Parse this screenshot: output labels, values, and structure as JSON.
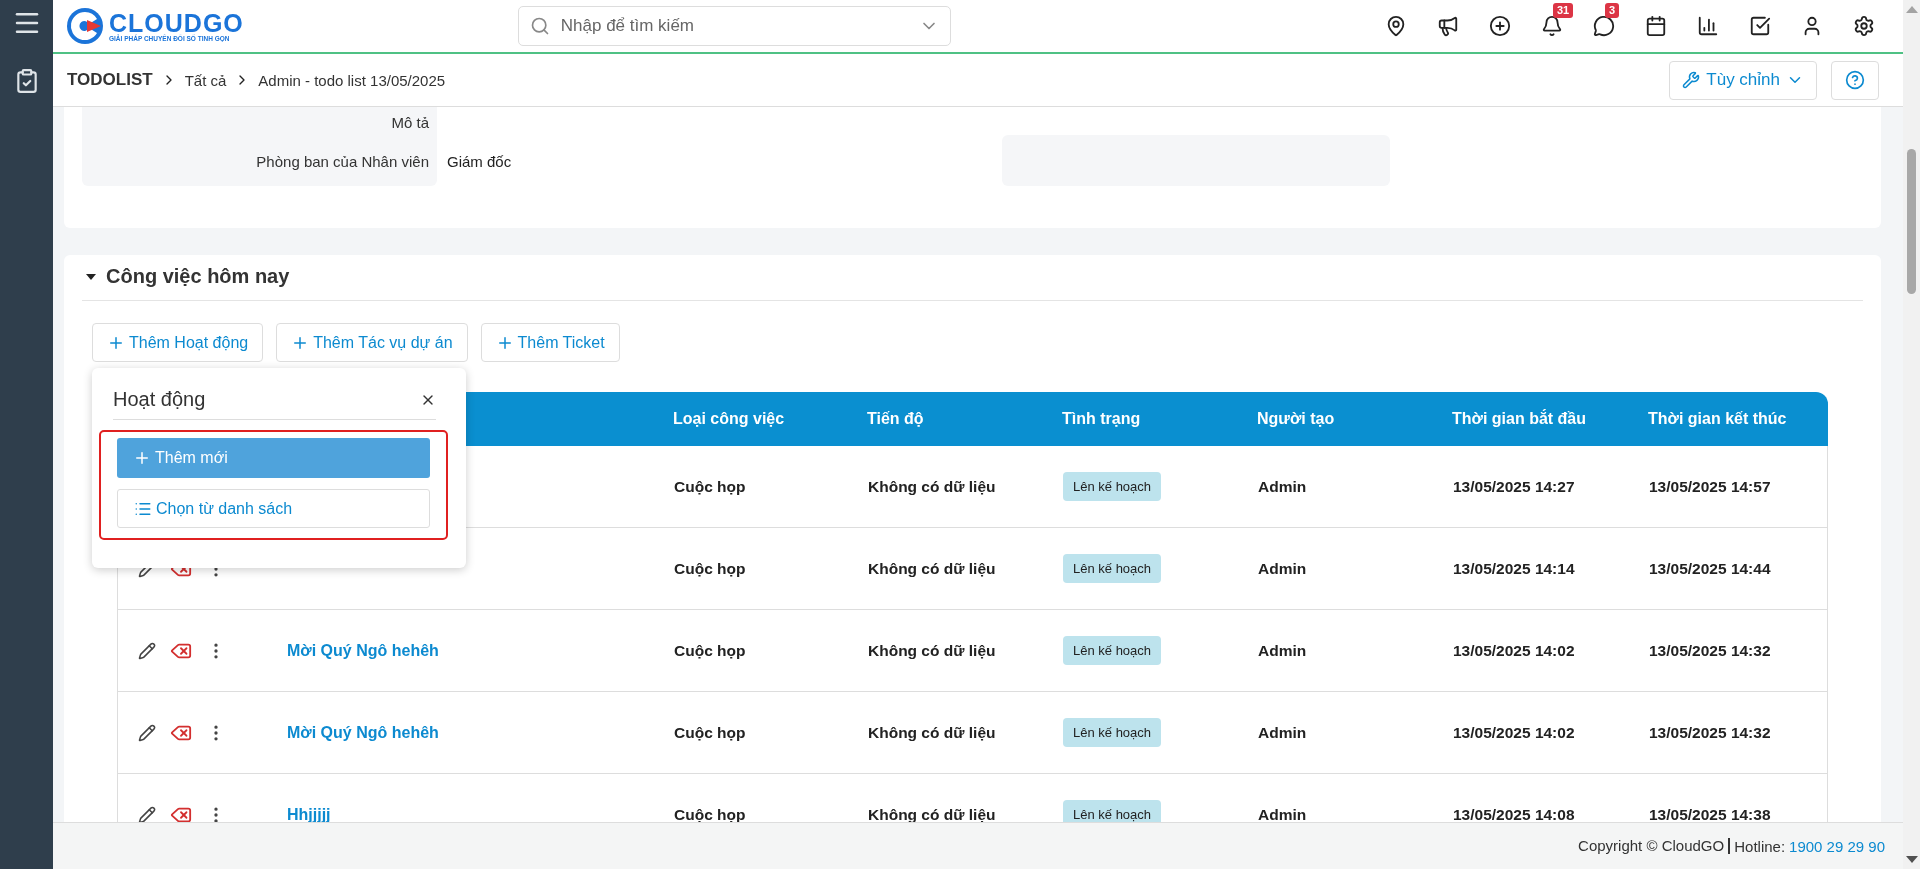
{
  "header": {
    "logo": {
      "name": "CLOUDGO",
      "tagline": "GIẢI PHÁP CHUYỂN ĐỔI SỐ TINH GỌN"
    },
    "search": {
      "placeholder": "Nhập để tìm kiếm"
    },
    "icons": [
      {
        "kind": "location"
      },
      {
        "kind": "megaphone"
      },
      {
        "kind": "add"
      },
      {
        "kind": "bell",
        "badge": "31"
      },
      {
        "kind": "chat",
        "badge": "3"
      },
      {
        "kind": "calendar"
      },
      {
        "kind": "chart"
      },
      {
        "kind": "task"
      },
      {
        "kind": "user"
      },
      {
        "kind": "settings"
      }
    ]
  },
  "breadcrumb": [
    "TODOLIST",
    "Tất cả",
    "Admin - todo list 13/05/2025"
  ],
  "toolbar": {
    "customize": "Tùy chỉnh"
  },
  "details": [
    {
      "label": "Mô tả"
    },
    {
      "label": "Phòng ban của Nhân viên",
      "value": "Giám đốc"
    }
  ],
  "section": {
    "title": "Công việc hôm nay",
    "expanded": true,
    "add_buttons": [
      "Thêm Hoạt động",
      "Thêm Tác vụ dự án",
      "Thêm Ticket"
    ],
    "table": {
      "columns": [
        "Loại công việc",
        "Tiến độ",
        "Tình trạng",
        "Người tạo",
        "Thời gian bắt đầu",
        "Thời gian kết thúc"
      ],
      "rows": [
        {
          "type": "Cuộc họp",
          "progress": "Không có dữ liệu",
          "status": "Lên kế hoạch",
          "creator": "Admin",
          "start": "13/05/2025 14:27",
          "end": "13/05/2025 14:57"
        },
        {
          "actions": true,
          "type": "Cuộc họp",
          "progress": "Không có dữ liệu",
          "status": "Lên kế hoạch",
          "creator": "Admin",
          "start": "13/05/2025 14:14",
          "end": "13/05/2025 14:44"
        },
        {
          "actions": true,
          "name": "Mời Quý Ngô hehêh",
          "type": "Cuộc họp",
          "progress": "Không có dữ liệu",
          "status": "Lên kế hoạch",
          "creator": "Admin",
          "start": "13/05/2025 14:02",
          "end": "13/05/2025 14:32"
        },
        {
          "actions": true,
          "name": "Mời Quý Ngô hehêh",
          "type": "Cuộc họp",
          "progress": "Không có dữ liệu",
          "status": "Lên kế hoạch",
          "creator": "Admin",
          "start": "13/05/2025 14:02",
          "end": "13/05/2025 14:32"
        },
        {
          "actions": true,
          "name": "Hhjjjjj",
          "type": "Cuộc họp",
          "progress": "Không có dữ liệu",
          "status": "Lên kế hoạch",
          "creator": "Admin",
          "start": "13/05/2025 14:08",
          "end": "13/05/2025 14:38"
        }
      ]
    }
  },
  "popup": {
    "title": "Hoạt động",
    "add_new": "Thêm mới",
    "choose": "Chọn từ danh sách"
  },
  "footer": {
    "copyright": "Copyright © CloudGO",
    "hotline_label": "Hotline:",
    "phone": "1900 29 29 90"
  }
}
